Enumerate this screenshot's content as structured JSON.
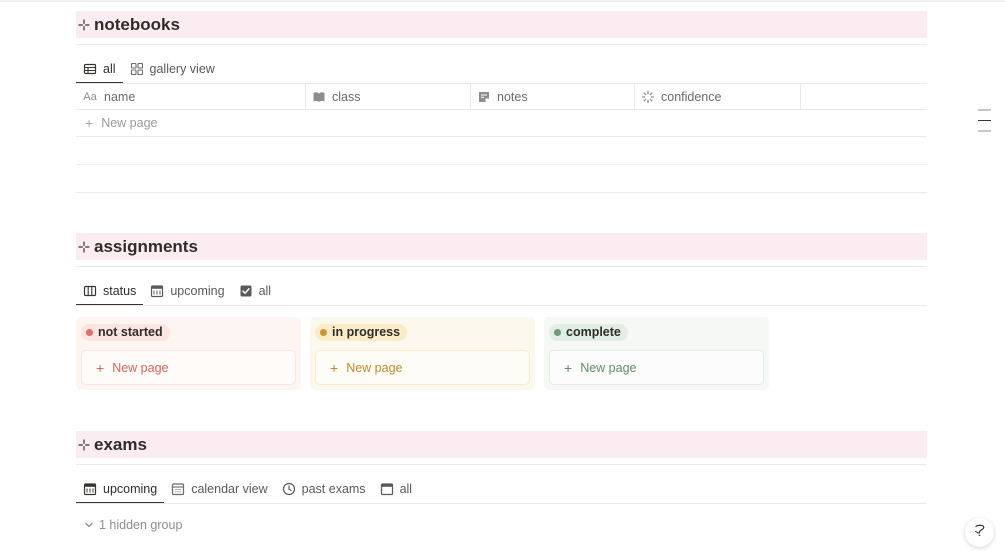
{
  "notebooks": {
    "title": "notebooks",
    "tabs": [
      {
        "label": "all",
        "icon": "table-icon",
        "active": true
      },
      {
        "label": "gallery view",
        "icon": "gallery-icon",
        "active": false
      }
    ],
    "columns": [
      {
        "label": "name",
        "icon": "text-property-icon",
        "icon_text": "Aa"
      },
      {
        "label": "class",
        "icon": "book-icon"
      },
      {
        "label": "notes",
        "icon": "note-icon"
      },
      {
        "label": "confidence",
        "icon": "loading-icon"
      }
    ],
    "new_page_label": "New page"
  },
  "assignments": {
    "title": "assignments",
    "tabs": [
      {
        "label": "status",
        "icon": "board-icon",
        "active": true
      },
      {
        "label": "upcoming",
        "icon": "calendar-icon",
        "active": false
      },
      {
        "label": "all",
        "icon": "checkbox-icon",
        "active": false
      }
    ],
    "board_columns": [
      {
        "status": "not started",
        "new_page_label": "New page",
        "bg": "#fdf5f2",
        "pill_bg": "#fbe4e1",
        "dot": "#e16f64",
        "accent": "#d9665b"
      },
      {
        "status": "in progress",
        "new_page_label": "New page",
        "bg": "#fdf8ee",
        "pill_bg": "#fbecc9",
        "dot": "#cb9433",
        "accent": "#c4892d"
      },
      {
        "status": "complete",
        "new_page_label": "New page",
        "bg": "#f5f8f5",
        "pill_bg": "#e1eee3",
        "dot": "#6c9b76",
        "accent": "#5f8c67"
      }
    ]
  },
  "exams": {
    "title": "exams",
    "tabs": [
      {
        "label": "upcoming",
        "icon": "calendar-icon",
        "active": true
      },
      {
        "label": "calendar view",
        "icon": "calendar-view-icon",
        "active": false
      },
      {
        "label": "past exams",
        "icon": "clock-icon",
        "active": false
      },
      {
        "label": "all",
        "icon": "calendar-icon",
        "active": false
      }
    ],
    "hidden_group_label": "1 hidden group"
  },
  "colors": {
    "section_header_bg": "#fbecf1",
    "text": "#37352f",
    "muted": "#9b9a97"
  }
}
